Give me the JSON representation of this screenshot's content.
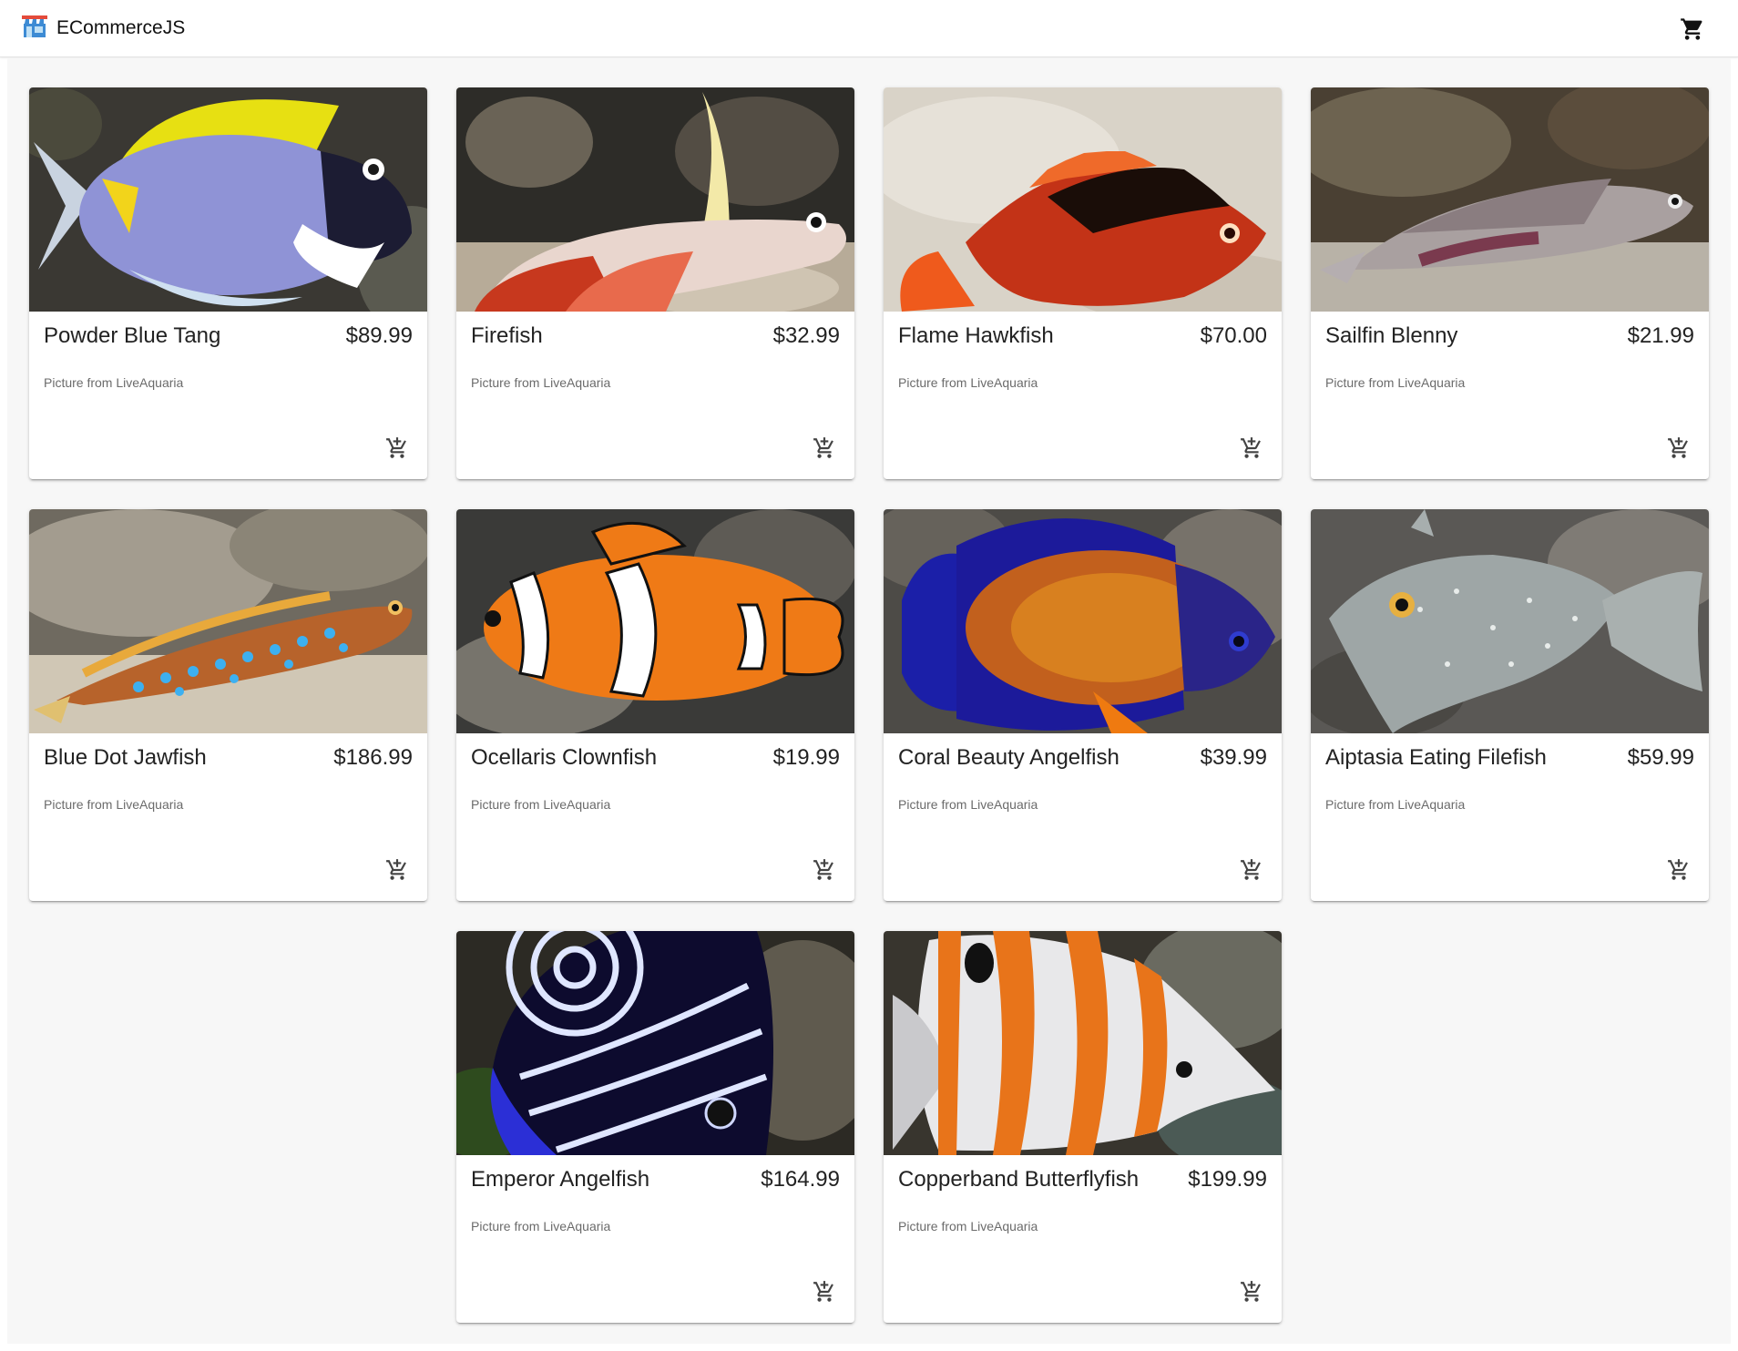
{
  "app": {
    "title": "ECommerceJS"
  },
  "products": [
    {
      "name": "Powder Blue Tang",
      "price": "$89.99",
      "caption": "Picture from LiveAquaria"
    },
    {
      "name": "Firefish",
      "price": "$32.99",
      "caption": "Picture from LiveAquaria"
    },
    {
      "name": "Flame Hawkfish",
      "price": "$70.00",
      "caption": "Picture from LiveAquaria"
    },
    {
      "name": "Sailfin Blenny",
      "price": "$21.99",
      "caption": "Picture from LiveAquaria"
    },
    {
      "name": "Blue Dot Jawfish",
      "price": "$186.99",
      "caption": "Picture from LiveAquaria"
    },
    {
      "name": "Ocellaris Clownfish",
      "price": "$19.99",
      "caption": "Picture from LiveAquaria"
    },
    {
      "name": "Coral Beauty Angelfish",
      "price": "$39.99",
      "caption": "Picture from LiveAquaria"
    },
    {
      "name": "Aiptasia Eating Filefish",
      "price": "$59.99",
      "caption": "Picture from LiveAquaria"
    },
    {
      "name": "Emperor Angelfish",
      "price": "$164.99",
      "caption": "Picture from LiveAquaria"
    },
    {
      "name": "Copperband Butterflyfish",
      "price": "$199.99",
      "caption": "Picture from LiveAquaria"
    }
  ],
  "icons": {
    "logo": "store-icon",
    "cart": "shopping-cart-icon",
    "add_to_cart": "add-shopping-cart-icon"
  }
}
